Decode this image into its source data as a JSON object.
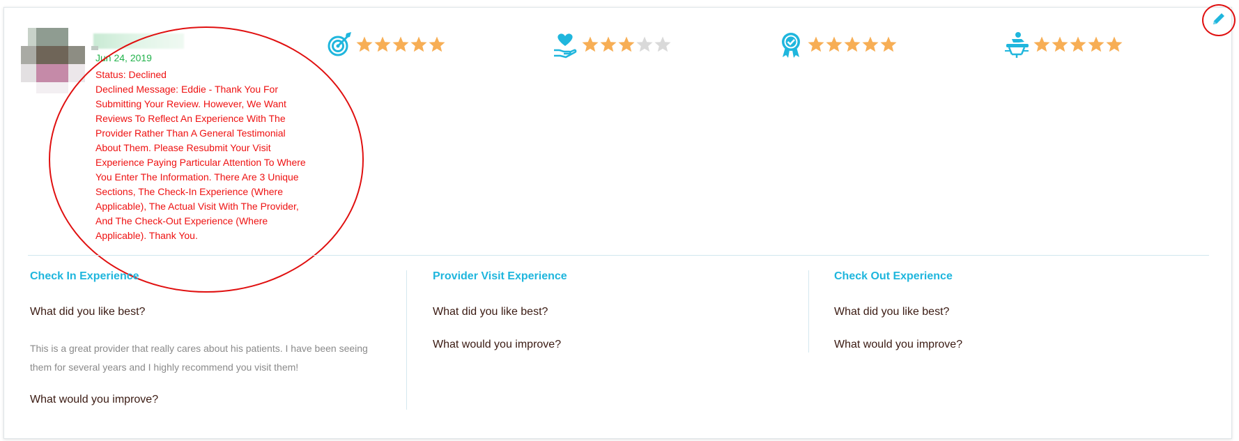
{
  "review": {
    "date": "Jun 24, 2019",
    "status": "Status: Declined",
    "declined_message": "Declined Message: Eddie - Thank You For Submitting Your Review. However, We Want Reviews To Reflect An Experience With The Provider Rather Than A General Testimonial About Them. Please Resubmit Your Visit Experience Paying Particular Attention To Where You Enter The Information. There Are 3 Unique Sections, The Check-In Experience (Where Applicable), The Actual Visit With The Provider, And The Check-Out Experience (Where Applicable). Thank You."
  },
  "ratings": [
    {
      "icon": "target-icon",
      "stars": 5,
      "max": 5
    },
    {
      "icon": "heart-hand-icon",
      "stars": 3,
      "max": 5
    },
    {
      "icon": "award-ribbon-icon",
      "stars": 5,
      "max": 5
    },
    {
      "icon": "massage-table-icon",
      "stars": 5,
      "max": 5
    }
  ],
  "sections": {
    "check_in": {
      "title": "Check In Experience",
      "liked_question": "What did you like best?",
      "liked_answer": "This is a great provider that really cares about his patients. I have been seeing them for several years and I highly recommend you visit them!",
      "improve_question": "What would you improve?"
    },
    "provider_visit": {
      "title": "Provider Visit Experience",
      "liked_question": "What did you like best?",
      "improve_question": "What would you improve?"
    },
    "check_out": {
      "title": "Check Out Experience",
      "liked_question": "What did you like best?",
      "improve_question": "What would you improve?"
    }
  },
  "colors": {
    "accent": "#1fb6dd",
    "star_on": "#f7ae55",
    "star_off": "#d9d9d9",
    "date": "#21b24b",
    "declined": "#ee1111"
  }
}
